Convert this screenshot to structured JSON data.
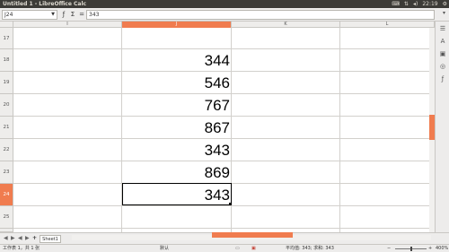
{
  "window": {
    "title": "Untitled 1 - LibreOffice Calc",
    "clock": "22:19"
  },
  "formula_bar": {
    "name_box": "J24",
    "formula_value": "343"
  },
  "columns": [
    "I",
    "J",
    "K",
    "L"
  ],
  "selected_column": "J",
  "rows": [
    {
      "num": "17",
      "value": ""
    },
    {
      "num": "18",
      "value": "344"
    },
    {
      "num": "19",
      "value": "546"
    },
    {
      "num": "20",
      "value": "767"
    },
    {
      "num": "21",
      "value": "867"
    },
    {
      "num": "22",
      "value": "343"
    },
    {
      "num": "23",
      "value": "869"
    },
    {
      "num": "24",
      "value": "343"
    },
    {
      "num": "25",
      "value": ""
    }
  ],
  "selected_row": "24",
  "sheet_tabs": {
    "nav_buttons": [
      "◀",
      "▶",
      "◀",
      "▶"
    ],
    "add_label": "+",
    "active_sheet": "Sheet1"
  },
  "statusbar": {
    "sheet_info": "工作表 1，共 1 张",
    "page_style": "默认",
    "sum_info": "平均值: 343; 求和: 343",
    "zoom": "400%"
  },
  "colors": {
    "accent": "#f07c4f",
    "titlebar": "#3c3b37"
  }
}
